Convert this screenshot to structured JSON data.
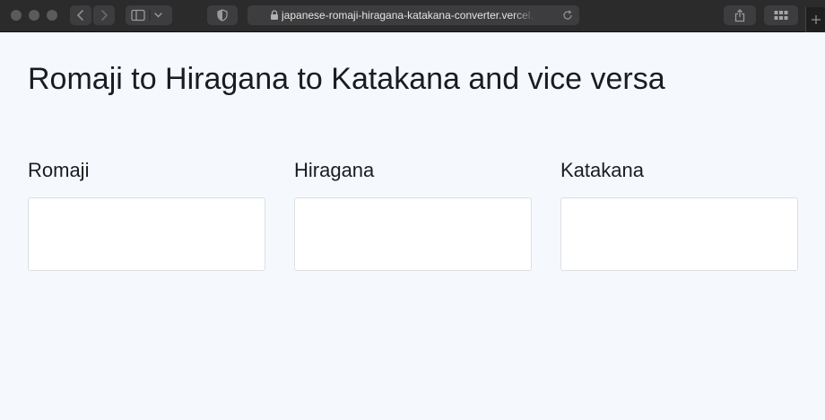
{
  "browser": {
    "url": "japanese-romaji-hiragana-katakana-converter.vercel.app",
    "icons": {
      "back": "chevron-left-icon",
      "forward": "chevron-right-icon",
      "sidebar": "sidebar-icon",
      "shield": "shield-icon",
      "lock": "lock-icon",
      "reload": "reload-icon",
      "share": "share-icon",
      "tabs": "tab-overview-icon",
      "new_tab": "plus-icon"
    }
  },
  "page": {
    "title": "Romaji to Hiragana to Katakana and vice versa",
    "columns": [
      {
        "label": "Romaji",
        "value": ""
      },
      {
        "label": "Hiragana",
        "value": ""
      },
      {
        "label": "Katakana",
        "value": ""
      }
    ]
  },
  "colors": {
    "page_background": "#f5f8fc",
    "toolbar_background": "#2b2b2c",
    "text": "#1a1c20",
    "input_border": "#dcdfe3"
  }
}
